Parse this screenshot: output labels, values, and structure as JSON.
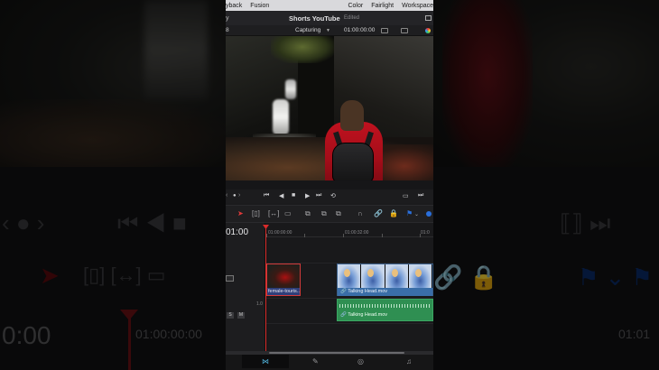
{
  "menubar": {
    "items": [
      "yback",
      "Fusion",
      "Color",
      "Fairlight",
      "Workspace"
    ]
  },
  "titlebar": {
    "project_name": "Shorts YouTube",
    "status": "Edited",
    "back_glyph": "y"
  },
  "viewer_bar": {
    "left_num": "8",
    "capture_label": "Capturing",
    "timecode": "01:00:00:00"
  },
  "timeline": {
    "current_timecode": "01:00",
    "ruler_labels": [
      "01:00:00:00",
      "01:00:32:00",
      "01:0"
    ],
    "audio_gain": "1.0",
    "solo_label": "S",
    "mute_label": "M",
    "track_id": "",
    "clips": {
      "v1_name": "female-touris...",
      "v2_name": "Talking Head.mov",
      "a1_name": "Talking Head.mov"
    }
  },
  "backdrop": {
    "left_timecode": "0:00",
    "left_ruler": "01:00:00:00",
    "right_ruler": "01:01"
  },
  "colors": {
    "playhead": "#d92a2a",
    "video_clip_label": "#3a6ea8",
    "audio_clip": "#2f8f52",
    "accent": "#4fb0d8"
  }
}
